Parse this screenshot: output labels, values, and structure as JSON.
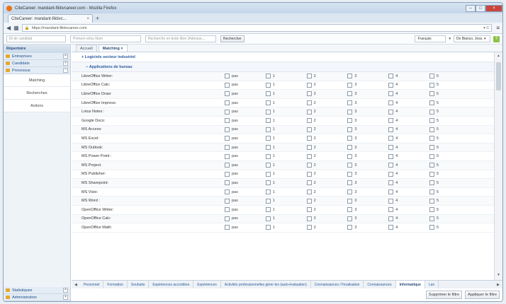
{
  "browser": {
    "window_title": "CiteCareer: mandant-fiktivcareer.com - Mozilla Firefox",
    "tab_label": "CiteCareer: mandant-fiktivc...",
    "url": "https://mandant-fiktivcareer.com"
  },
  "app": {
    "search_id_placeholder": "ID de candidat",
    "search_name_placeholder": "Prénom et/ou Nom",
    "search_fulltext_placeholder": "Recherche en texte libre (Adresse,...",
    "search_button": "Rechercher",
    "language": "Français",
    "user": "De Bianco, Jess. ▾"
  },
  "sidebar": {
    "header": "Répertoire",
    "items": [
      {
        "label": "Entreprises",
        "toggle": "+"
      },
      {
        "label": "Candidats",
        "toggle": "+"
      },
      {
        "label": "Processus",
        "toggle": "−"
      }
    ],
    "subitems": [
      "Matching",
      "Recherches",
      "Actions"
    ],
    "bottom_items": [
      {
        "label": "Statistiques",
        "toggle": "+"
      },
      {
        "label": "Administration",
        "toggle": "+"
      }
    ]
  },
  "main": {
    "tabs": [
      "Accueil",
      "Matching ×"
    ],
    "section": "Logiciels secteur industriel",
    "subsection": "Applications de bureau",
    "levels": [
      "pas",
      "1",
      "2",
      "3",
      "4",
      "5"
    ],
    "rows": [
      "LibreOffice Writer:",
      "LibreOffice Calc:",
      "LibreOffice Draw:",
      "LibreOffice Impress:",
      "Lotus Notes :",
      "Google Docs:",
      "MS Access:",
      "MS Excel:",
      "MS Outlook:",
      "MS Power Point :",
      "MS Project:",
      "MS Publisher:",
      "MS Sharepoint:",
      "MS Visio:",
      "MS Word :",
      "OpenOffice Writer:",
      "OpenOffice Calc:",
      "OpenOffice Math:"
    ],
    "bottom_tabs": [
      "Personnel",
      "Formation",
      "Souhaits",
      "Expériences accordées",
      "Expériences",
      "Activités professionnelles gérer les (auto-évaluation)",
      "Connaissances / Finalisation",
      "Connaissances",
      "Informatique",
      "Lan"
    ],
    "active_bottom_tab": "Informatique",
    "action_buttons": [
      "Supprimer le filtre",
      "Appliquer le filtre"
    ]
  }
}
